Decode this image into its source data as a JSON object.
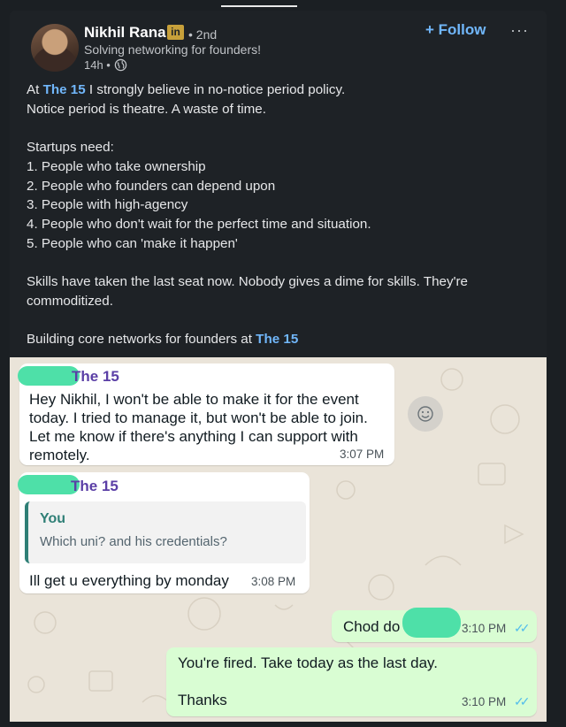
{
  "post": {
    "author_name": "Nikhil Rana",
    "badge": "in",
    "degree": "• 2nd",
    "headline": "Solving networking for founders!",
    "time": "14h •",
    "follow_label": "+ Follow",
    "more_label": "···",
    "text": {
      "line1_pre": "At ",
      "line1_link": "The 15",
      "line1_post": " I strongly believe in no-notice period policy.",
      "line2": "Notice period is theatre. A waste of time.",
      "line3": "Startups need:",
      "list": [
        "1. People who take ownership",
        "2. People who founders can depend upon",
        "3. People with high-agency",
        "4. People who don't wait for the perfect time and situation.",
        "5. People who can 'make it happen'"
      ],
      "skills_1": "Skills have taken the last seat now. Nobody gives a dime for skills. They're",
      "skills_2": "commoditized.",
      "closing_pre": "Building core networks for founders at ",
      "closing_link": "The 15"
    }
  },
  "chat": {
    "messages": [
      {
        "sender": "The 15",
        "lines": [
          "Hey Nikhil, I won't be able to make it for the event",
          "today. I tried to manage it, but won't be able to join.",
          "Let me know if there's anything I can support with",
          "remotely."
        ],
        "time": "3:07 PM"
      },
      {
        "sender": "The 15",
        "quote_author": "You",
        "quote_text": "Which uni? and his credentials?",
        "text": "Ill get u everything by monday",
        "time": "3:08 PM"
      },
      {
        "text": "Chod do",
        "time": "3:10 PM",
        "ticks": "✓✓"
      },
      {
        "line1": "You're fired. Take today as the last day.",
        "line2": "Thanks",
        "time": "3:10 PM",
        "ticks": "✓✓"
      }
    ]
  },
  "colors": {
    "link": "#71b7fb",
    "card_bg": "#1e2226",
    "chat_bg": "#eae4d9",
    "outgoing_bubble": "#d9fdd3",
    "sender_name": "#5b3fa6",
    "read_ticks": "#53bdeb"
  },
  "icons": [
    "linkedin-badge-icon",
    "globe-icon",
    "emoji-icon",
    "double-check-icon",
    "more-icon"
  ]
}
